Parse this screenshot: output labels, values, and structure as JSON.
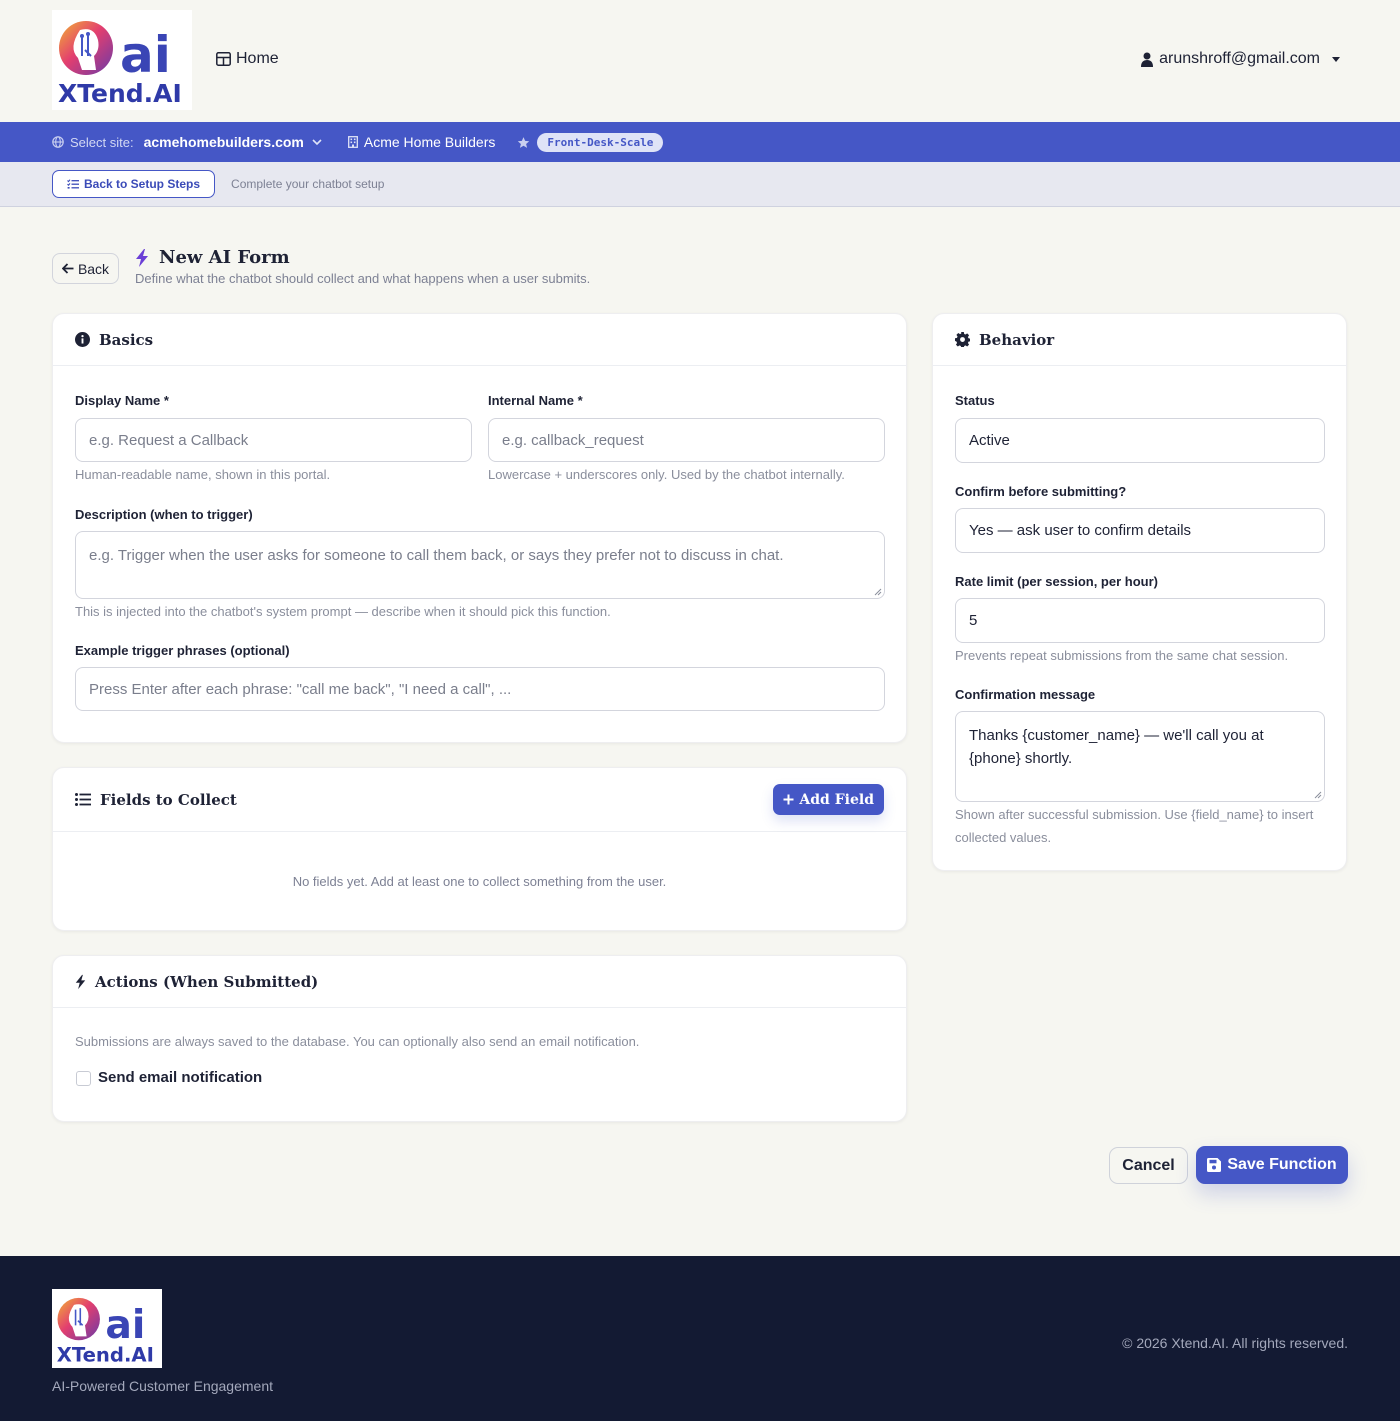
{
  "brand": {
    "logo_mark": "ai",
    "logo_text": "XTend.AI"
  },
  "nav": {
    "home_label": "Home",
    "user_email": "arunshroff@gmail.com"
  },
  "sitebar": {
    "select_label": "Select site:",
    "site": "acmehomebuilders.com",
    "business": "Acme Home Builders",
    "plan": "Front-Desk-Scale"
  },
  "setup": {
    "back_label": "Back to Setup Steps",
    "hint": "Complete your chatbot setup"
  },
  "page": {
    "back_label": "Back",
    "title": "New AI Form",
    "subtitle": "Define what the chatbot should collect and what happens when a user submits."
  },
  "basics": {
    "title": "Basics",
    "display_name_label": "Display Name *",
    "display_name_placeholder": "e.g. Request a Callback",
    "display_name_help": "Human-readable name, shown in this portal.",
    "internal_name_label": "Internal Name *",
    "internal_name_placeholder": "e.g. callback_request",
    "internal_name_help": "Lowercase + underscores only. Used by the chatbot internally.",
    "description_label": "Description (when to trigger)",
    "description_placeholder": "e.g. Trigger when the user asks for someone to call them back, or says they prefer not to discuss in chat.",
    "description_help": "This is injected into the chatbot's system prompt — describe when it should pick this function.",
    "phrases_label": "Example trigger phrases (optional)",
    "phrases_placeholder": "Press Enter after each phrase: \"call me back\", \"I need a call\", ..."
  },
  "fields": {
    "title": "Fields to Collect",
    "add_label": "Add Field",
    "empty": "No fields yet. Add at least one to collect something from the user."
  },
  "actions": {
    "title": "Actions (When Submitted)",
    "note": "Submissions are always saved to the database. You can optionally also send an email notification.",
    "email_label": "Send email notification",
    "email_checked": false
  },
  "behavior": {
    "title": "Behavior",
    "status_label": "Status",
    "status_value": "Active",
    "confirm_label": "Confirm before submitting?",
    "confirm_value": "Yes — ask user to confirm details",
    "rate_label": "Rate limit (per session, per hour)",
    "rate_value": "5",
    "rate_help": "Prevents repeat submissions from the same chat session.",
    "message_label": "Confirmation message",
    "message_value": "Thanks {customer_name} — we'll call you at {phone} shortly.",
    "message_help": "Shown after successful submission. Use {field_name} to insert collected values."
  },
  "buttons": {
    "cancel": "Cancel",
    "save": "Save Function"
  },
  "footer": {
    "tagline": "AI-Powered Customer Engagement",
    "copyright": "© 2026 Xtend.AI. All rights reserved."
  },
  "colors": {
    "primary": "#4557c6",
    "footer_bg": "#131a33",
    "page_bg": "#f6f6f1"
  },
  "icons": [
    "grid-icon",
    "user-icon",
    "globe-icon",
    "chevron-down-icon",
    "building-icon",
    "star-icon",
    "list-check-icon",
    "arrow-left-icon",
    "bolt-icon",
    "info-icon",
    "list-icon",
    "plus-icon",
    "gear-icon",
    "save-icon"
  ]
}
